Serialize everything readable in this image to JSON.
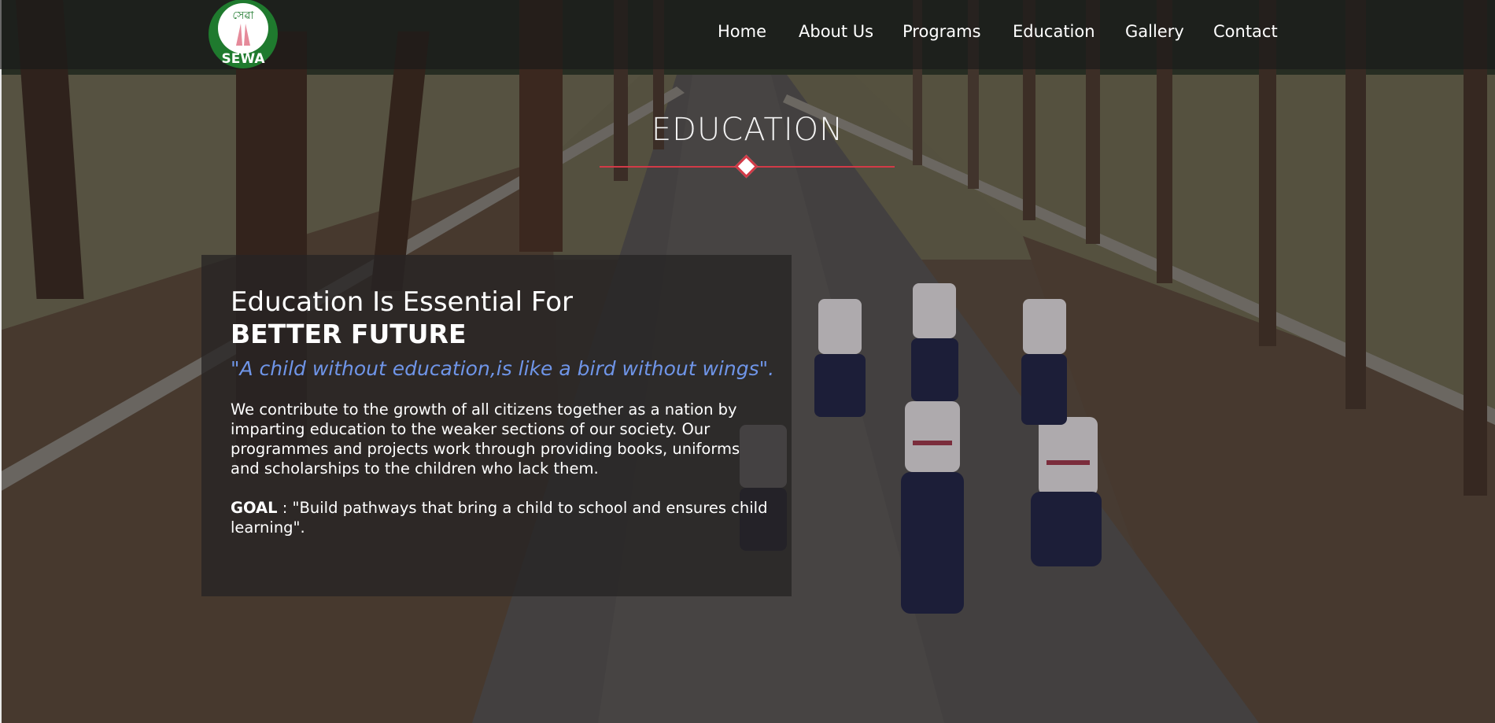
{
  "brand": {
    "logo_top_text": "সেৱা",
    "logo_bottom_text": "SEWA",
    "logo_ring_color": "#1f7a2e",
    "logo_hands_color": "#e58a9a"
  },
  "nav": {
    "items": [
      {
        "label": "Home"
      },
      {
        "label": "About Us"
      },
      {
        "label": "Programs"
      },
      {
        "label": "Education"
      },
      {
        "label": "Gallery"
      },
      {
        "label": "Contact"
      }
    ]
  },
  "hero": {
    "section_title": "EDUCATION",
    "accent_color": "#d23a47"
  },
  "card": {
    "heading": "Education Is Essential For",
    "heading_bold": "BETTER FUTURE",
    "quote": "\"A child without education,is like a bird without wings\".",
    "body": "We contribute to the growth of all citizens together as a nation by imparting education to the weaker sections of our society. Our programmes and projects work through providing books, uniforms and scholarships to the children who lack them.",
    "goal_label": "GOAL",
    "goal_text": " : \"Build pathways that bring a child to school and ensures child learning\"."
  },
  "colors": {
    "quote_color": "#6f95e8",
    "header_bg": "rgba(24,24,24,0.62)",
    "card_bg": "rgba(38,36,36,0.78)"
  }
}
